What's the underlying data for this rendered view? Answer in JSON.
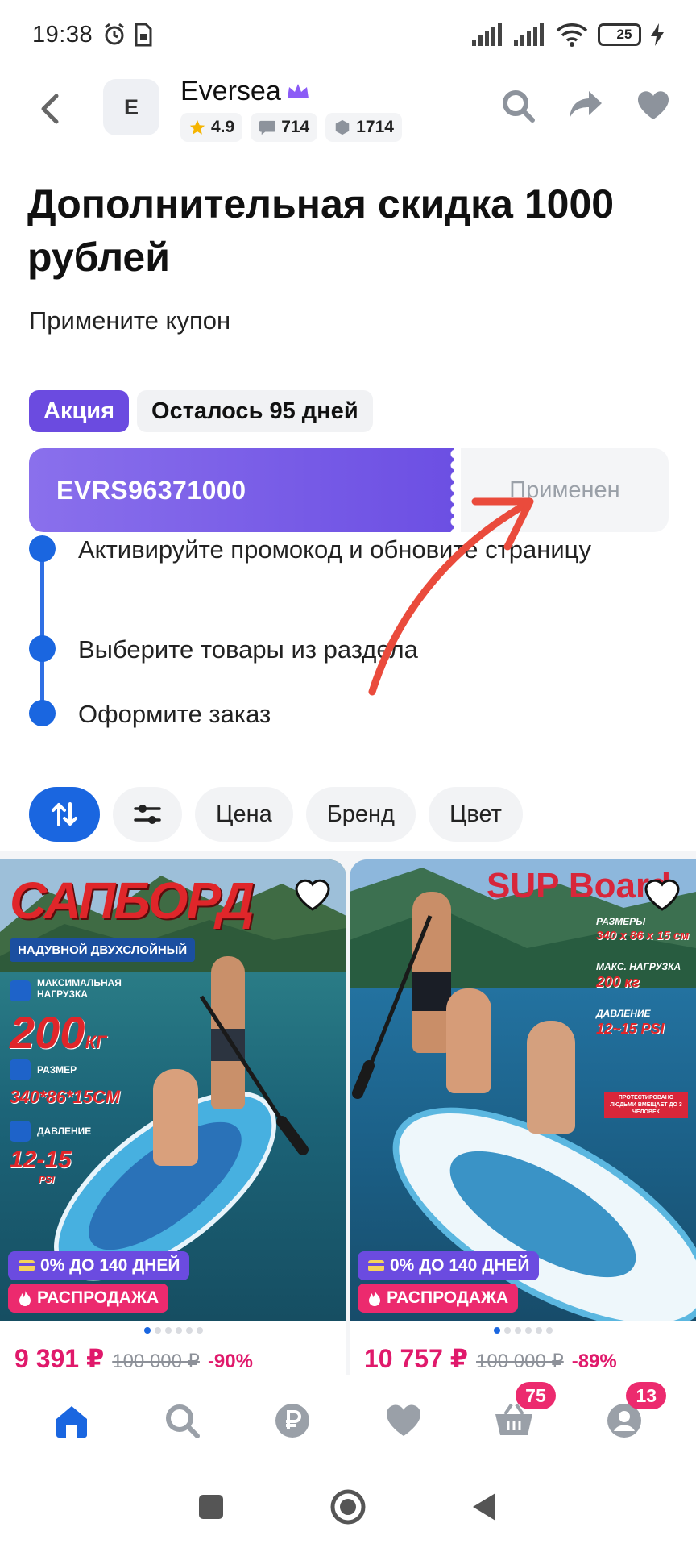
{
  "status_bar": {
    "time": "19:38",
    "battery": "25",
    "network_label": "6"
  },
  "header": {
    "logo_letter": "E",
    "shop_name": "Eversea",
    "rating": "4.9",
    "reviews": "714",
    "orders": "1714"
  },
  "promo": {
    "title": "Дополнительная скидка 1000 рублей",
    "subtitle": "Примените купон",
    "badge_type": "Акция",
    "badge_days": "Осталось 95 дней",
    "coupon_code": "EVRS96371000",
    "coupon_status": "Применен",
    "steps": [
      "Активируйте промокод и обновите страницу",
      "Выберите товары из раздела",
      "Оформите заказ"
    ]
  },
  "filters": {
    "chips": [
      "Цена",
      "Бренд",
      "Цвет"
    ]
  },
  "products": [
    {
      "image_title": "САПБОРД",
      "image_subtitle": "НАДУВНОЙ ДВУХСЛОЙНЫЙ",
      "spec_load_label": "МАКСИМАЛЬНАЯ НАГРУЗКА",
      "spec_load_value": "200",
      "spec_load_unit": "КГ",
      "spec_size_label": "РАЗМЕР",
      "spec_size_value": "340*86*15СМ",
      "spec_pressure_label": "ДАВЛЕНИЕ",
      "spec_pressure_value": "12-15",
      "spec_pressure_unit": "PSI",
      "tag_installment": "0% ДО 140 ДНЕЙ",
      "tag_sale": "РАСПРОДАЖА",
      "price": "9 391 ₽",
      "old_price": "100 000 ₽",
      "discount": "-90%"
    },
    {
      "image_title": "SUP Board",
      "spec_size_label": "РАЗМЕРЫ",
      "spec_size_value": "340 x 86 x 15 см",
      "spec_load_label": "МАКС. НАГРУЗКА",
      "spec_load_value": "200 кг",
      "spec_pressure_label": "ДАВЛЕНИЕ",
      "spec_pressure_value": "12~15 PSI",
      "tested_note": "ПРОТЕСТИРОВАНО ЛЮДЬМИ ВМЕЩАЕТ ДО 3 ЧЕЛОВЕК",
      "tag_installment": "0% ДО 140 ДНЕЙ",
      "tag_sale": "РАСПРОДАЖА",
      "price": "10 757 ₽",
      "old_price": "100 000 ₽",
      "discount": "-89%"
    }
  ],
  "bottom_nav": {
    "cart_count": "75",
    "profile_count": "13"
  },
  "colors": {
    "accent_blue": "#1a66e0",
    "promo_purple": "#6b4be0",
    "sale_pink": "#ec2a6e",
    "price_pink": "#e0196b"
  }
}
